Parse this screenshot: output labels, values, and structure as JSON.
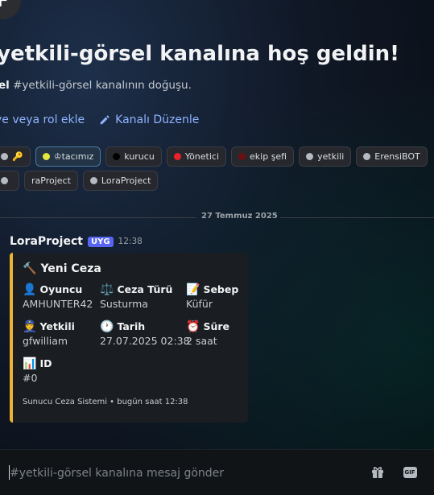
{
  "channel": {
    "avatar_letter": "F",
    "welcome_title": "yetkili-görsel kanalına hoş geldin!",
    "subtitle_bold": "el",
    "subtitle_rest": " #yetkili-görsel kanalının doğuşu.",
    "add_role_label": "ye veya rol ekle",
    "edit_channel_label": "Kanalı Düzenle"
  },
  "tags": [
    {
      "label": "🔑",
      "color": "#b5bac1"
    },
    {
      "label": "♔tacımız",
      "color": "#e6e640"
    },
    {
      "label": "kurucu",
      "color": "#000000"
    },
    {
      "label": "Yönetici",
      "color": "#e8232b"
    },
    {
      "label": "ekip şefi",
      "color": "#6b0f12"
    },
    {
      "label": "yetkili",
      "color": "#b5bac1"
    },
    {
      "label": "ErensiBOT",
      "color": "#b5bac1"
    },
    {
      "label": "",
      "color": "#b5bac1"
    },
    {
      "label": "raProject",
      "color": ""
    },
    {
      "label": "LoraProject",
      "color": "#b5bac1"
    }
  ],
  "divider_date": "27 Temmuz 2025",
  "message": {
    "author": "LoraProject",
    "badge": "UYG",
    "time": "12:38",
    "embed": {
      "title": "Yeni Ceza",
      "title_icon": "🔨",
      "fields": [
        {
          "icon": "👤",
          "name": "Oyuncu",
          "value": "AMHUNTER42"
        },
        {
          "icon": "⚖️",
          "name": "Ceza Türü",
          "value": "Susturma"
        },
        {
          "icon": "📝",
          "name": "Sebep",
          "value": "Küfür"
        },
        {
          "icon": "👮",
          "name": "Yetkili",
          "value": "gfwilliam"
        },
        {
          "icon": "🕐",
          "name": "Tarih",
          "value": "27.07.2025 02:38"
        },
        {
          "icon": "⏰",
          "name": "Süre",
          "value": "2 saat"
        },
        {
          "icon": "📊",
          "name": "ID",
          "value": "#0"
        }
      ],
      "footer": "Sunucu Ceza Sistemi • bugün saat 12:38",
      "accent_color": "#f0b232"
    }
  },
  "composer": {
    "placeholder": "#yetkili-görsel kanalına mesaj gönder",
    "gif_label": "GIF"
  }
}
